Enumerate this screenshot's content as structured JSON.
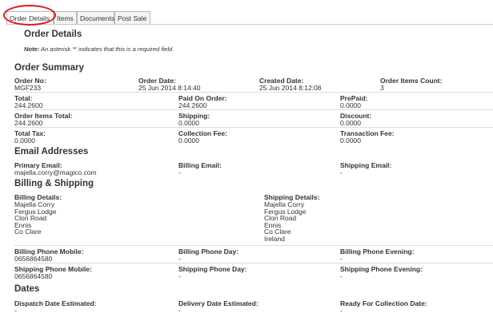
{
  "tabs": [
    "Order Details",
    "Items",
    "Documents",
    "Post Sale"
  ],
  "page_title": "Order Details",
  "note": {
    "prefix": "Note:",
    "text": "An asterisk '*' indicates that this is a required field."
  },
  "sections": {
    "order_summary": "Order Summary",
    "email_addresses": "Email Addresses",
    "billing_shipping": "Billing & Shipping",
    "dates": "Dates"
  },
  "order_summary": {
    "order_no": {
      "label": "Order No:",
      "value": "MGF233"
    },
    "order_date": {
      "label": "Order Date:",
      "value": "25 Jun 2014 8:14:40"
    },
    "created_date": {
      "label": "Created Date:",
      "value": "25 Jun 2014 8:12:08"
    },
    "order_items_count": {
      "label": "Order Items Count:",
      "value": "3"
    },
    "total": {
      "label": "Total:",
      "value": "244.2600"
    },
    "paid_on_order": {
      "label": "Paid On Order:",
      "value": "244.2600"
    },
    "prepaid": {
      "label": "PrePaid:",
      "value": "0.0000"
    },
    "order_items_total": {
      "label": "Order Items Total:",
      "value": "244.2600"
    },
    "shipping": {
      "label": "Shipping:",
      "value": "0.0000"
    },
    "discount": {
      "label": "Discount:",
      "value": "0.0000"
    },
    "total_tax": {
      "label": "Total Tax:",
      "value": "0.0000"
    },
    "collection_fee": {
      "label": "Collection Fee:",
      "value": "0.0000"
    },
    "transaction_fee": {
      "label": "Transaction Fee:",
      "value": "0.0000"
    }
  },
  "emails": {
    "primary": {
      "label": "Primary Email:",
      "value": "majella.corry@magico.com"
    },
    "billing": {
      "label": "Billing Email:",
      "value": "-"
    },
    "shipping": {
      "label": "Shipping Email:",
      "value": "-"
    }
  },
  "billing_shipping": {
    "billing_details": {
      "label": "Billing Details:",
      "lines": [
        "Majella Corry",
        "Fergus Lodge",
        "Clon Road",
        "Ennis",
        "Co Clare"
      ]
    },
    "shipping_details": {
      "label": "Shipping Details:",
      "lines": [
        "Majella Corry",
        "Fergus Lodge",
        "Clon Road",
        "Ennis",
        "Co Clare",
        "Ireland"
      ]
    },
    "billing_phone_mobile": {
      "label": "Billing Phone Mobile:",
      "value": "0656864580"
    },
    "billing_phone_day": {
      "label": "Billing Phone Day:",
      "value": "-"
    },
    "billing_phone_evening": {
      "label": "Billing Phone Evening:",
      "value": "-"
    },
    "shipping_phone_mobile": {
      "label": "Shipping Phone Mobile:",
      "value": "0656864580"
    },
    "shipping_phone_day": {
      "label": "Shipping Phone Day:",
      "value": "-"
    },
    "shipping_phone_evening": {
      "label": "Shipping Phone Evening:",
      "value": "-"
    }
  },
  "dates": {
    "dispatch_date_estimated": {
      "label": "Dispatch Date Estimated:",
      "value": "-"
    },
    "delivery_date_estimated": {
      "label": "Delivery Date Estimated:",
      "value": "-"
    },
    "ready_for_collection_date": {
      "label": "Ready For Collection Date:",
      "value": "-"
    }
  },
  "colors": {
    "highlight_ring": "#e1141c"
  }
}
